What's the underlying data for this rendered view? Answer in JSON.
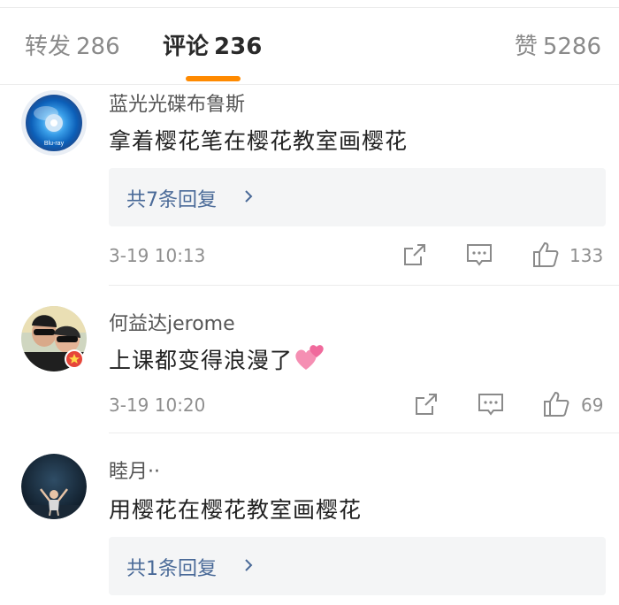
{
  "tabs": {
    "repost_label": "转发",
    "repost_count": "286",
    "comments_label": "评论",
    "comments_count": "236",
    "likes_label": "赞",
    "likes_count": "5286",
    "active": "comments",
    "indicator_color": "#ff8a00"
  },
  "comments": [
    {
      "username": "蓝光光碟布鲁斯",
      "text": "拿着樱花笔在樱花教室画樱花",
      "reply_summary": "共7条回复",
      "time": "3-19 10:13",
      "likes": "133",
      "avatar": "bluray-disc-icon"
    },
    {
      "username": "何益达jerome",
      "text": "上课都变得浪漫了",
      "emoji": "two-hearts-emoji",
      "time": "3-19 10:20",
      "likes": "69",
      "avatar": "couple-photo-avatar",
      "badge": "verified-badge"
    },
    {
      "username": "睦月··",
      "text": "用樱花在樱花教室画樱花",
      "reply_summary": "共1条回复",
      "avatar": "person-night-avatar"
    }
  ],
  "colors": {
    "link_blue": "#4a6a98",
    "muted_text": "#8f8f8f",
    "reply_bg": "#f4f5f6"
  },
  "icons": {
    "share": "share-icon",
    "comment": "comment-icon",
    "like": "thumbs-up-icon",
    "chevron": "chevron-right-icon"
  }
}
